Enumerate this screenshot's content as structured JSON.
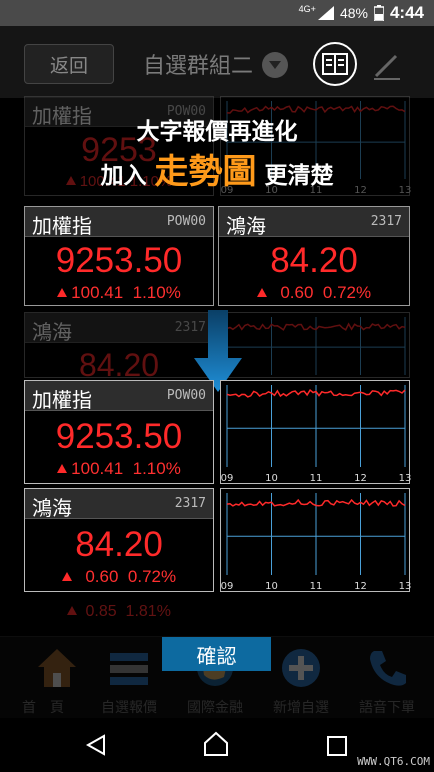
{
  "status_bar": {
    "network": "4G+",
    "battery": "48%",
    "time": "4:44"
  },
  "toolbar": {
    "back_label": "返回",
    "group_title": "自選群組二"
  },
  "overlay": {
    "line1": "大字報價再進化",
    "line2_prefix": "加入",
    "line2_highlight": "走勢圖",
    "line2_suffix": "更清楚",
    "confirm_label": "確認"
  },
  "background": {
    "top_small": {
      "name": "加權指",
      "code": "POW00",
      "price": "9253",
      "change": "100.41",
      "pct": "1.10%"
    },
    "time_ticks": [
      "09",
      "10",
      "11",
      "12",
      "13"
    ],
    "large_cards": [
      {
        "name": "加權指",
        "code": "POW00",
        "price": "9253.50",
        "change": "100.41",
        "pct": "1.10%"
      },
      {
        "name": "鴻海",
        "code": "2317",
        "price": "84.20",
        "change": "0.60",
        "pct": "0.72%"
      }
    ],
    "dim_row": {
      "name": "鴻海",
      "code": "2317",
      "price": "84.20"
    },
    "bottom_dim": {
      "change": "0.85",
      "pct": "1.81%"
    }
  },
  "foreground": {
    "rows": [
      {
        "name": "加權指",
        "code": "POW00",
        "price": "9253.50",
        "change": "100.41",
        "pct": "1.10%"
      },
      {
        "name": "鴻海",
        "code": "2317",
        "price": "84.20",
        "change": "0.60",
        "pct": "0.72%"
      }
    ]
  },
  "bottom_nav": [
    "首　頁",
    "自選報價",
    "國際金融",
    "新增自選",
    "語音下單"
  ],
  "watermark": "WWW.QT6.COM",
  "colors": {
    "price_up": "#ff2a2a",
    "highlight": "#ff9a1a",
    "confirm": "#0d6aa0",
    "chart_line": "#ff2a2a",
    "grid": "#4aa0d8"
  }
}
